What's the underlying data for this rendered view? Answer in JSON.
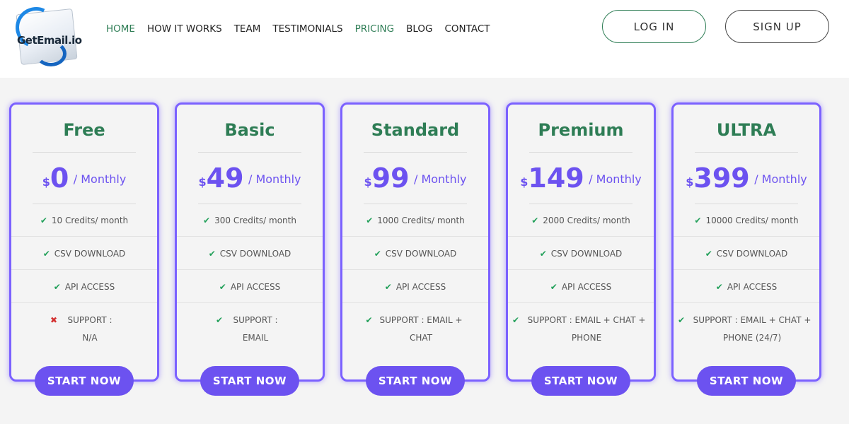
{
  "brand": {
    "logo_text": "GetEmail.io"
  },
  "nav": [
    {
      "label": "HOME",
      "active": true
    },
    {
      "label": "HOW IT WORKS",
      "active": false
    },
    {
      "label": "TEAM",
      "active": false
    },
    {
      "label": "TESTIMONIALS",
      "active": false
    },
    {
      "label": "PRICING",
      "active": true
    },
    {
      "label": "BLOG",
      "active": false
    },
    {
      "label": "CONTACT",
      "active": false
    }
  ],
  "auth": {
    "login_label": "LOG IN",
    "signup_label": "SIGN UP"
  },
  "colors": {
    "accent": "#6c52f0",
    "brand_green": "#2e7d55",
    "check": "#22a05a",
    "cross": "#d32f2f"
  },
  "plans": [
    {
      "name": "Free",
      "currency": "$",
      "price": "0",
      "period": "/ Monthly",
      "features": [
        {
          "text": "10 Credits/ month",
          "included": true
        },
        {
          "text": "CSV DOWNLOAD",
          "included": true
        },
        {
          "text": "API ACCESS",
          "included": true
        },
        {
          "text": "SUPPORT : N/A",
          "included": false
        }
      ],
      "cta": "START NOW"
    },
    {
      "name": "Basic",
      "currency": "$",
      "price": "49",
      "period": "/ Monthly",
      "features": [
        {
          "text": "300 Credits/ month",
          "included": true
        },
        {
          "text": "CSV DOWNLOAD",
          "included": true
        },
        {
          "text": "API ACCESS",
          "included": true
        },
        {
          "text": "SUPPORT : EMAIL",
          "included": true
        }
      ],
      "cta": "START NOW"
    },
    {
      "name": "Standard",
      "currency": "$",
      "price": "99",
      "period": "/ Monthly",
      "features": [
        {
          "text": "1000 Credits/ month",
          "included": true
        },
        {
          "text": "CSV DOWNLOAD",
          "included": true
        },
        {
          "text": "API ACCESS",
          "included": true
        },
        {
          "text": "SUPPORT : EMAIL + CHAT",
          "included": true
        }
      ],
      "cta": "START NOW"
    },
    {
      "name": "Premium",
      "currency": "$",
      "price": "149",
      "period": "/ Monthly",
      "features": [
        {
          "text": "2000 Credits/ month",
          "included": true
        },
        {
          "text": "CSV DOWNLOAD",
          "included": true
        },
        {
          "text": "API ACCESS",
          "included": true
        },
        {
          "text": "SUPPORT : EMAIL + CHAT + PHONE",
          "included": true
        }
      ],
      "cta": "START NOW"
    },
    {
      "name": "ULTRA",
      "currency": "$",
      "price": "399",
      "period": "/ Monthly",
      "features": [
        {
          "text": "10000 Credits/ month",
          "included": true
        },
        {
          "text": "CSV DOWNLOAD",
          "included": true
        },
        {
          "text": "API ACCESS",
          "included": true
        },
        {
          "text": "SUPPORT : EMAIL + CHAT + PHONE (24/7)",
          "included": true
        }
      ],
      "cta": "START NOW"
    }
  ]
}
